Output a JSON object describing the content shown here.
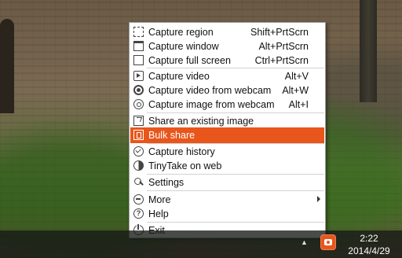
{
  "menu": {
    "items": [
      {
        "label": "Capture region",
        "shortcut": "Shift+PrtScrn",
        "icon": "region-icon"
      },
      {
        "label": "Capture window",
        "shortcut": "Alt+PrtScrn",
        "icon": "window-icon"
      },
      {
        "label": "Capture full screen",
        "shortcut": "Ctrl+PrtScrn",
        "icon": "fullscreen-icon"
      },
      {
        "label": "Capture video",
        "shortcut": "Alt+V",
        "icon": "video-icon"
      },
      {
        "label": "Capture video from webcam",
        "shortcut": "Alt+W",
        "icon": "webcam-video-icon"
      },
      {
        "label": "Capture image from webcam",
        "shortcut": "Alt+I",
        "icon": "webcam-image-icon"
      },
      {
        "label": "Share an existing image",
        "shortcut": "",
        "icon": "share-image-icon"
      },
      {
        "label": "Bulk share",
        "shortcut": "",
        "icon": "bulk-share-icon"
      },
      {
        "label": "Capture history",
        "shortcut": "",
        "icon": "history-icon"
      },
      {
        "label": "TinyTake on web",
        "shortcut": "",
        "icon": "web-icon"
      },
      {
        "label": "Settings",
        "shortcut": "",
        "icon": "settings-icon"
      },
      {
        "label": "More",
        "shortcut": "",
        "icon": "more-icon"
      },
      {
        "label": "Help",
        "shortcut": "",
        "icon": "help-icon"
      },
      {
        "label": "Exit",
        "shortcut": "",
        "icon": "exit-icon"
      }
    ],
    "highlighted_item": "Bulk share",
    "highlight_color": "#e8561c"
  },
  "taskbar": {
    "time": "2:22",
    "date": "2014/4/29",
    "tray_icon": "tinytake-icon",
    "tray_icon_color": "#e8561c"
  }
}
